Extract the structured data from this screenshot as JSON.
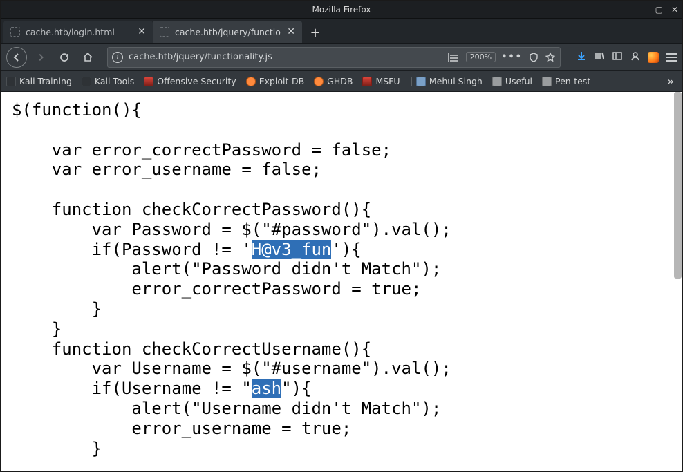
{
  "window": {
    "title": "Mozilla Firefox"
  },
  "tabs": [
    {
      "label": "cache.htb/login.html",
      "active": false
    },
    {
      "label": "cache.htb/jquery/functionalit",
      "active": true
    }
  ],
  "url": {
    "value": "cache.htb/jquery/functionality.js",
    "zoom": "200%"
  },
  "bookmarks": [
    {
      "label": "Kali Training",
      "icon": "dark"
    },
    {
      "label": "Kali Tools",
      "icon": "dark"
    },
    {
      "label": "Offensive Security",
      "icon": "red"
    },
    {
      "label": "Exploit-DB",
      "icon": "bug"
    },
    {
      "label": "GHDB",
      "icon": "bug"
    },
    {
      "label": "MSFU",
      "icon": "red"
    },
    {
      "label": "Mehul Singh",
      "icon": "ppl"
    },
    {
      "label": "Useful",
      "icon": "folder"
    },
    {
      "label": "Pen-test",
      "icon": "folder"
    }
  ],
  "code": {
    "l1": "$(function(){",
    "l2": "    ",
    "l3": "    var error_correctPassword = false;",
    "l4": "    var error_username = false;",
    "l5": "    ",
    "l6": "    function checkCorrectPassword(){",
    "l7": "        var Password = $(\"#password\").val();",
    "l8a": "        if(Password != '",
    "l8h": "H@v3_fun",
    "l8b": "'){",
    "l9": "            alert(\"Password didn't Match\");",
    "l10": "            error_correctPassword = true;",
    "l11": "        }",
    "l12": "    }",
    "l13": "    function checkCorrectUsername(){",
    "l14": "        var Username = $(\"#username\").val();",
    "l15a": "        if(Username != \"",
    "l15h": "ash",
    "l15b": "\"){",
    "l16": "            alert(\"Username didn't Match\");",
    "l17": "            error_username = true;",
    "l18": "        }"
  }
}
